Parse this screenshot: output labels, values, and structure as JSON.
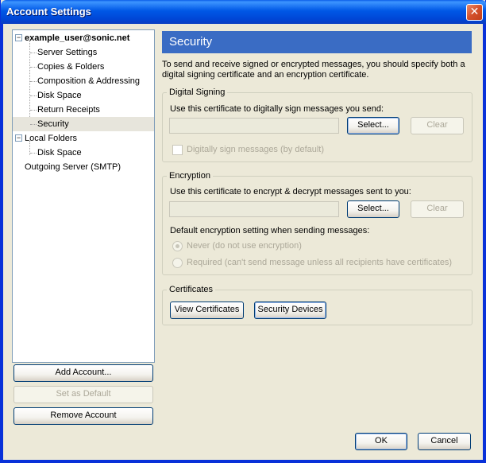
{
  "window": {
    "title": "Account Settings",
    "close_glyph": "✕"
  },
  "tree": {
    "items": [
      {
        "label": "example_user@sonic.net",
        "expander": "−"
      },
      {
        "label": "Server Settings"
      },
      {
        "label": "Copies & Folders"
      },
      {
        "label": "Composition & Addressing"
      },
      {
        "label": "Disk Space"
      },
      {
        "label": "Return Receipts"
      },
      {
        "label": "Security",
        "selected": true
      },
      {
        "label": "Local Folders",
        "expander": "−"
      },
      {
        "label": "Disk Space"
      },
      {
        "label": "Outgoing Server (SMTP)"
      }
    ]
  },
  "account_buttons": {
    "add": "Add Account...",
    "set_default": "Set as Default",
    "remove": "Remove Account"
  },
  "panel": {
    "title": "Security",
    "description": "To send and receive signed or encrypted messages, you should specify both a digital signing certificate and an encryption certificate."
  },
  "digital_signing": {
    "legend": "Digital Signing",
    "instruction": "Use this certificate to digitally sign messages you send:",
    "certificate_value": "",
    "select_label": "Select...",
    "clear_label": "Clear",
    "checkbox_label": "Digitally sign messages (by default)"
  },
  "encryption": {
    "legend": "Encryption",
    "instruction": "Use this certificate to encrypt & decrypt messages sent to you:",
    "certificate_value": "",
    "select_label": "Select...",
    "clear_label": "Clear",
    "default_setting_label": "Default encryption setting when sending messages:",
    "option_never": "Never (do not use encryption)",
    "option_required": "Required (can't send message unless all recipients have certificates)",
    "selected_option": "Never (do not use encryption)"
  },
  "certificates": {
    "legend": "Certificates",
    "view_label": "View Certificates",
    "devices_label": "Security Devices"
  },
  "dialog_buttons": {
    "ok": "OK",
    "cancel": "Cancel"
  }
}
